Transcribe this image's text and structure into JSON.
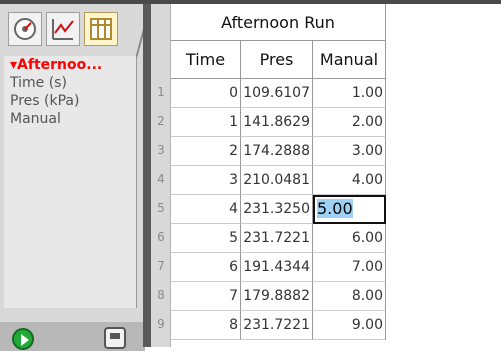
{
  "sidebar": {
    "tabs": [
      {
        "icon": "gauge-icon"
      },
      {
        "icon": "graph-icon"
      },
      {
        "icon": "table-icon"
      }
    ],
    "variables": [
      {
        "label": "▾Afternoo...",
        "selected": true
      },
      {
        "label": "Time (s)",
        "selected": false
      },
      {
        "label": "Pres (kPa)",
        "selected": false
      },
      {
        "label": "Manual",
        "selected": false
      }
    ],
    "bottom": {
      "play_icon": "play-icon",
      "calc_icon": "calculator-icon"
    }
  },
  "table": {
    "dataset_title": "Afternoon Run",
    "columns": [
      "Time",
      "Pres",
      "Manual"
    ],
    "rows": [
      {
        "n": "1",
        "time": "0",
        "pres": "109.6107",
        "manual": "1.00"
      },
      {
        "n": "2",
        "time": "1",
        "pres": "141.8629",
        "manual": "2.00"
      },
      {
        "n": "3",
        "time": "2",
        "pres": "174.2888",
        "manual": "3.00"
      },
      {
        "n": "4",
        "time": "3",
        "pres": "210.0481",
        "manual": "4.00"
      },
      {
        "n": "5",
        "time": "4",
        "pres": "231.3250",
        "manual": "5.00",
        "editing": true
      },
      {
        "n": "6",
        "time": "5",
        "pres": "231.7221",
        "manual": "6.00"
      },
      {
        "n": "7",
        "time": "6",
        "pres": "191.4344",
        "manual": "7.00"
      },
      {
        "n": "8",
        "time": "7",
        "pres": "179.8882",
        "manual": "8.00"
      },
      {
        "n": "9",
        "time": "8",
        "pres": "231.7221",
        "manual": "9.00"
      }
    ],
    "editing_value": "5.00"
  },
  "colors": {
    "selected_var": "#ff0000",
    "edit_highlight": "#9ed2f5",
    "play_green": "#23a83a"
  }
}
